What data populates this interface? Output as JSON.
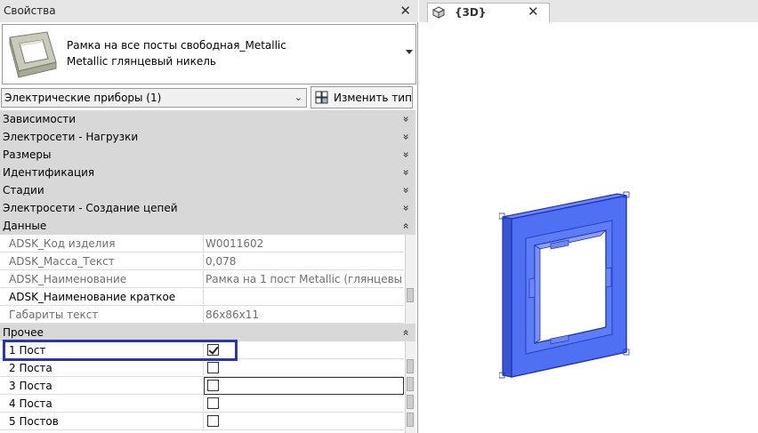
{
  "properties": {
    "title": "Свойства",
    "close_glyph": "✕",
    "type_selector": {
      "line1": "Рамка на все посты свободная_Metallic",
      "line2": "Metallic глянцевый никель"
    },
    "category_filter": "Электрические приборы (1)",
    "edit_type_label": "Изменить тип",
    "groups": [
      {
        "label": "Зависимости",
        "icon": "»"
      },
      {
        "label": "Электросети - Нагрузки",
        "icon": "»"
      },
      {
        "label": "Размеры",
        "icon": "»"
      },
      {
        "label": "Идентификация",
        "icon": "»"
      },
      {
        "label": "Стадии",
        "icon": "»"
      },
      {
        "label": "Электросети - Создание цепей",
        "icon": "»"
      },
      {
        "label": "Данные",
        "icon": "«"
      },
      {
        "label": "Прочее",
        "icon": "«"
      }
    ],
    "data_params": [
      {
        "name": "ADSK_Код изделия",
        "value": "W0011602"
      },
      {
        "name": "ADSK_Масса_Текст",
        "value": "0,078"
      },
      {
        "name": "ADSK_Наименование",
        "value": "Рамка на 1 пост Metallic (глянцевы..."
      },
      {
        "name": "ADSK_Наименование краткое",
        "value": ""
      },
      {
        "name": "Габариты текст",
        "value": "86x86x11"
      }
    ],
    "other_params": [
      {
        "name": "1 Пост",
        "checked": true
      },
      {
        "name": "2 Поста",
        "checked": false
      },
      {
        "name": "3 Поста",
        "checked": false
      },
      {
        "name": "4 Поста",
        "checked": false
      },
      {
        "name": "5 Постов",
        "checked": false
      }
    ]
  },
  "view": {
    "tab_label": "{3D}",
    "close_glyph": "✕"
  },
  "colors": {
    "highlight": "#2b36a8",
    "model_fill": "#4a6cf0",
    "model_edge": "#1e34b8"
  }
}
